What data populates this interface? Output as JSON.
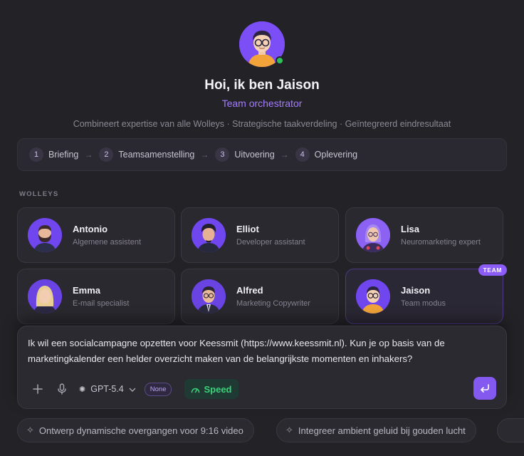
{
  "hero": {
    "title": "Hoi, ik ben Jaison",
    "role": "Team orchestrator",
    "description": "Combineert expertise van alle Wolleys · Strategische taakverdeling · Geïntegreerd eindresultaat",
    "status": "online"
  },
  "steps": [
    {
      "num": "1",
      "label": "Briefing"
    },
    {
      "num": "2",
      "label": "Teamsamenstelling"
    },
    {
      "num": "3",
      "label": "Uitvoering"
    },
    {
      "num": "4",
      "label": "Oplevering"
    }
  ],
  "section_label": "WOLLEYS",
  "agents": [
    {
      "name": "Antonio",
      "role": "Algemene assistent"
    },
    {
      "name": "Elliot",
      "role": "Developer assistant"
    },
    {
      "name": "Lisa",
      "role": "Neuromarketing expert"
    },
    {
      "name": "Emma",
      "role": "E-mail specialist"
    },
    {
      "name": "Alfred",
      "role": "Marketing Copywriter"
    },
    {
      "name": "Jaison",
      "role": "Team modus",
      "badge": "TEAM"
    }
  ],
  "composer": {
    "text": "Ik wil een socialcampagne opzetten voor Keessmit (https://www.keessmit.nl). Kun je op basis van de marketingkalender een helder overzicht maken van de belangrijkste momenten en inhakers?",
    "model": "GPT-5.4",
    "reasoning": "None",
    "speed_label": "Speed"
  },
  "suggestions": [
    "Ontwerp dynamische overgangen voor 9:16 video",
    "Integreer ambient geluid bij gouden lucht"
  ],
  "colors": {
    "background": "#232226",
    "accent": "#8b5cf6",
    "speed_green": "#3bd17a",
    "online": "#2fbf5a"
  }
}
